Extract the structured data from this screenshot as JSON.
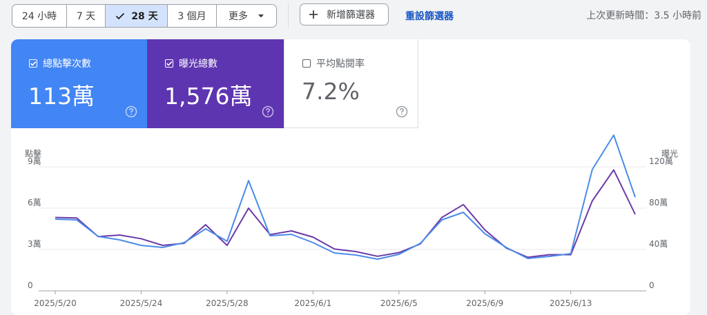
{
  "filters": {
    "ranges": [
      {
        "label": "24 小時",
        "selected": false
      },
      {
        "label": "7 天",
        "selected": false
      },
      {
        "label": "28 天",
        "selected": true
      },
      {
        "label": "3 個月",
        "selected": false
      }
    ],
    "more_label": "更多",
    "add_filter_label": "新增篩選器",
    "reset_label": "重設篩選器",
    "last_updated": "上次更新時間：3.5 小時前"
  },
  "metrics": [
    {
      "label": "總點擊次數",
      "value": "113萬",
      "checked": true,
      "color": "#4285f4"
    },
    {
      "label": "曝光總數",
      "value": "1,576萬",
      "checked": true,
      "color": "#5e35b1"
    },
    {
      "label": "平均點閱率",
      "value": "7.2%",
      "checked": false,
      "color": "#ffffff"
    }
  ],
  "chart_data": {
    "type": "line",
    "left_axis": {
      "label": "點擊",
      "ticks": [
        "0",
        "3萬",
        "6萬",
        "9萬"
      ],
      "range": [
        0,
        90000
      ]
    },
    "right_axis": {
      "label": "曝光",
      "ticks": [
        "0",
        "40萬",
        "80萬",
        "120萬"
      ],
      "range": [
        0,
        1200000
      ]
    },
    "x_tick_labels": [
      "2025/5/20",
      "2025/5/24",
      "2025/5/28",
      "2025/6/1",
      "2025/6/5",
      "2025/6/9",
      "2025/6/13"
    ],
    "x_tick_index": [
      0,
      4,
      8,
      12,
      16,
      20,
      24
    ],
    "series": [
      {
        "axis": "left",
        "color": "#4a8be8",
        "values": [
          52000,
          51500,
          39500,
          37000,
          33000,
          31500,
          35000,
          45000,
          36000,
          80000,
          40000,
          41000,
          35000,
          27500,
          26000,
          23000,
          26500,
          34500,
          51500,
          57000,
          41500,
          31500,
          23500,
          25000,
          27000,
          88000,
          113000,
          68000
        ]
      },
      {
        "axis": "right",
        "color": "#6a3aa8",
        "values": [
          710000,
          705000,
          525000,
          540000,
          505000,
          440000,
          460000,
          640000,
          440000,
          800000,
          545000,
          580000,
          520000,
          405000,
          380000,
          335000,
          370000,
          455000,
          710000,
          835000,
          590000,
          415000,
          325000,
          350000,
          350000,
          870000,
          1170000,
          740000
        ]
      }
    ]
  }
}
